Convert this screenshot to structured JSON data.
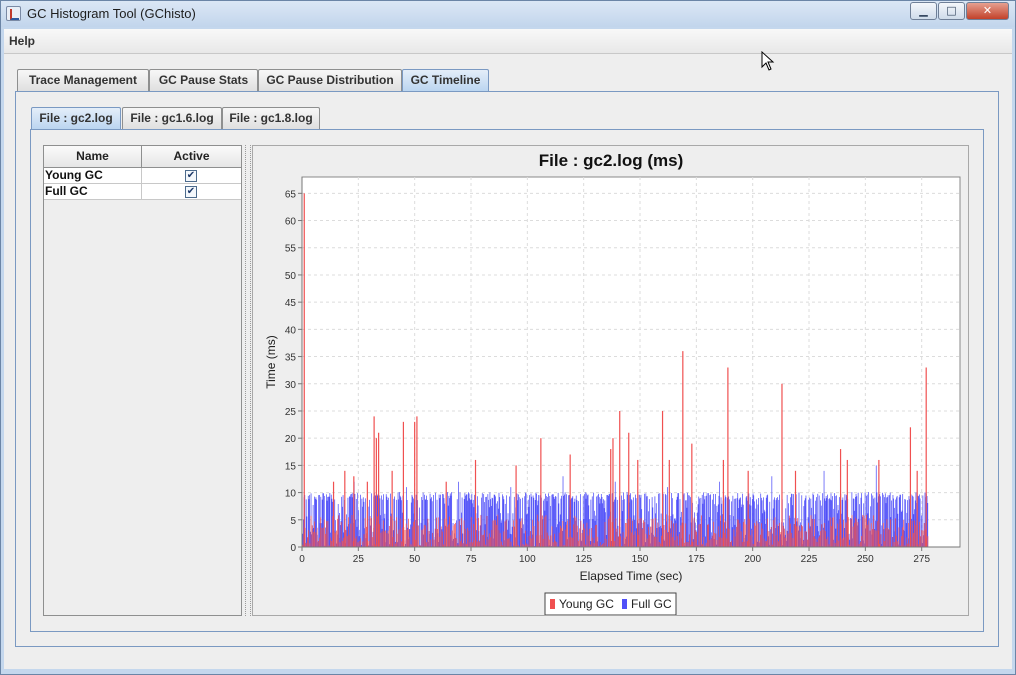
{
  "window": {
    "title": "GC Histogram Tool (GChisto)",
    "minimize_glyph": "▁",
    "maximize_glyph": "□",
    "close_glyph": "✕"
  },
  "menu": {
    "help": "Help"
  },
  "main_tabs": [
    {
      "label": "Trace Management",
      "selected": false
    },
    {
      "label": "GC Pause Stats",
      "selected": false
    },
    {
      "label": "GC Pause Distribution",
      "selected": false
    },
    {
      "label": "GC Timeline",
      "selected": true
    }
  ],
  "file_tabs": [
    {
      "label": "File : gc2.log",
      "selected": true
    },
    {
      "label": "File : gc1.6.log",
      "selected": false
    },
    {
      "label": "File : gc1.8.log",
      "selected": false
    }
  ],
  "table": {
    "headers": [
      "Name",
      "Active"
    ],
    "rows": [
      {
        "name": "Young GC",
        "active": true,
        "check_glyph": "✔"
      },
      {
        "name": "Full GC",
        "active": true,
        "check_glyph": "✔"
      }
    ]
  },
  "colors": {
    "young": "#f05050",
    "full": "#5050f8",
    "tab_selected": "#b9d4f0"
  },
  "chart_data": {
    "type": "bar",
    "title": "File : gc2.log (ms)",
    "xlabel": "Elapsed Time (sec)",
    "ylabel": "Time (ms)",
    "xlim": [
      0,
      292
    ],
    "ylim": [
      0,
      68
    ],
    "xticks": [
      "0",
      "25",
      "50",
      "75",
      "100",
      "125",
      "150",
      "175",
      "200",
      "225",
      "250",
      "275"
    ],
    "yticks": [
      "0",
      "5",
      "10",
      "15",
      "20",
      "25",
      "30",
      "35",
      "40",
      "45",
      "50",
      "55",
      "60",
      "65"
    ],
    "grid": true,
    "legend_position": "bottom",
    "series": [
      {
        "name": "Young GC",
        "color": "#f05050",
        "x": [
          1,
          14,
          19,
          23,
          29,
          32,
          33,
          34,
          40,
          45,
          50,
          51,
          64,
          77,
          95,
          106,
          119,
          137,
          138,
          141,
          145,
          149,
          160,
          163,
          169,
          173,
          187,
          189,
          198,
          213,
          219,
          239,
          242,
          256,
          270,
          273,
          277
        ],
        "y": [
          65,
          12,
          14,
          13,
          12,
          24,
          20,
          21,
          14,
          23,
          23,
          24,
          12,
          16,
          15,
          20,
          17,
          18,
          20,
          25,
          21,
          16,
          25,
          16,
          36,
          19,
          16,
          33,
          14,
          30,
          14,
          18,
          16,
          16,
          22,
          14,
          33
        ]
      },
      {
        "name": "Full GC",
        "color": "#5050f8",
        "x_range": [
          0,
          278
        ],
        "typical_range": [
          0,
          10
        ],
        "peak_values": [
          13,
          12,
          11,
          12,
          11,
          13,
          12,
          11,
          12,
          13,
          14,
          15
        ]
      }
    ]
  }
}
